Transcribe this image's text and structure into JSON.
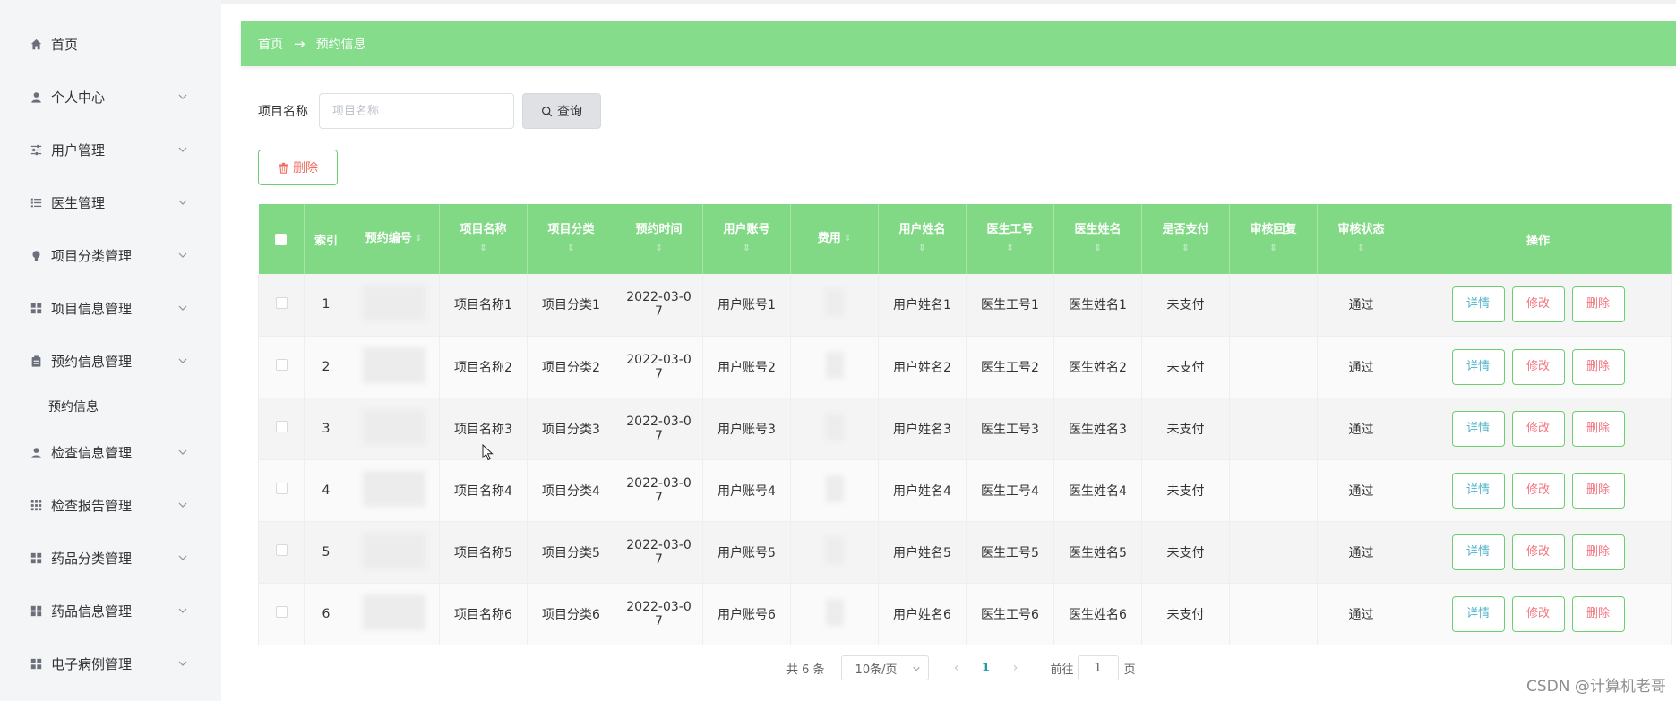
{
  "sidebar": {
    "items": [
      {
        "label": "首页",
        "icon": "home-icon",
        "has_arrow": false
      },
      {
        "label": "个人中心",
        "icon": "user-icon",
        "has_arrow": true
      },
      {
        "label": "用户管理",
        "icon": "sliders-icon",
        "has_arrow": true
      },
      {
        "label": "医生管理",
        "icon": "list-icon",
        "has_arrow": true
      },
      {
        "label": "项目分类管理",
        "icon": "bulb-icon",
        "has_arrow": true
      },
      {
        "label": "项目信息管理",
        "icon": "grid-icon",
        "has_arrow": true
      },
      {
        "label": "预约信息管理",
        "icon": "clipboard-icon",
        "has_arrow": true
      },
      {
        "label": "预约信息",
        "submenu": true
      },
      {
        "label": "检查信息管理",
        "icon": "user-icon",
        "has_arrow": true
      },
      {
        "label": "检查报告管理",
        "icon": "apps-icon",
        "has_arrow": true
      },
      {
        "label": "药品分类管理",
        "icon": "grid-icon",
        "has_arrow": true
      },
      {
        "label": "药品信息管理",
        "icon": "grid-icon",
        "has_arrow": true
      },
      {
        "label": "电子病例管理",
        "icon": "grid-icon",
        "has_arrow": true
      }
    ]
  },
  "breadcrumb": {
    "home": "首页",
    "separator": "→",
    "current": "预约信息"
  },
  "search": {
    "label": "项目名称",
    "placeholder": "项目名称",
    "value": "",
    "button_label": "查询"
  },
  "toolbar": {
    "delete_label": "删除"
  },
  "table": {
    "headers": {
      "index": "索引",
      "booking_no": "预约编号",
      "project_name": "项目名称",
      "project_category": "项目分类",
      "booking_time": "预约时间",
      "user_account": "用户账号",
      "fee": "费用",
      "user_name": "用户姓名",
      "doctor_id": "医生工号",
      "doctor_name": "医生姓名",
      "paid": "是否支付",
      "review_reply": "审核回复",
      "review_status": "审核状态",
      "actions": "操作"
    },
    "rows": [
      {
        "index": "1",
        "project_name": "项目名称1",
        "project_category": "项目分类1",
        "booking_time_1": "2022-03-0",
        "booking_time_2": "7",
        "user_account": "用户账号1",
        "user_name": "用户姓名1",
        "doctor_id": "医生工号1",
        "doctor_name": "医生姓名1",
        "paid": "未支付",
        "review_reply": "",
        "review_status": "通过"
      },
      {
        "index": "2",
        "project_name": "项目名称2",
        "project_category": "项目分类2",
        "booking_time_1": "2022-03-0",
        "booking_time_2": "7",
        "user_account": "用户账号2",
        "user_name": "用户姓名2",
        "doctor_id": "医生工号2",
        "doctor_name": "医生姓名2",
        "paid": "未支付",
        "review_reply": "",
        "review_status": "通过"
      },
      {
        "index": "3",
        "project_name": "项目名称3",
        "project_category": "项目分类3",
        "booking_time_1": "2022-03-0",
        "booking_time_2": "7",
        "user_account": "用户账号3",
        "user_name": "用户姓名3",
        "doctor_id": "医生工号3",
        "doctor_name": "医生姓名3",
        "paid": "未支付",
        "review_reply": "",
        "review_status": "通过"
      },
      {
        "index": "4",
        "project_name": "项目名称4",
        "project_category": "项目分类4",
        "booking_time_1": "2022-03-0",
        "booking_time_2": "7",
        "user_account": "用户账号4",
        "user_name": "用户姓名4",
        "doctor_id": "医生工号4",
        "doctor_name": "医生姓名4",
        "paid": "未支付",
        "review_reply": "",
        "review_status": "通过"
      },
      {
        "index": "5",
        "project_name": "项目名称5",
        "project_category": "项目分类5",
        "booking_time_1": "2022-03-0",
        "booking_time_2": "7",
        "user_account": "用户账号5",
        "user_name": "用户姓名5",
        "doctor_id": "医生工号5",
        "doctor_name": "医生姓名5",
        "paid": "未支付",
        "review_reply": "",
        "review_status": "通过"
      },
      {
        "index": "6",
        "project_name": "项目名称6",
        "project_category": "项目分类6",
        "booking_time_1": "2022-03-0",
        "booking_time_2": "7",
        "user_account": "用户账号6",
        "user_name": "用户姓名6",
        "doctor_id": "医生工号6",
        "doctor_name": "医生姓名6",
        "paid": "未支付",
        "review_reply": "",
        "review_status": "通过"
      }
    ],
    "action_labels": {
      "detail": "详情",
      "edit": "修改",
      "delete": "删除"
    }
  },
  "pagination": {
    "total": "共 6 条",
    "page_size": "10条/页",
    "current_page": "1",
    "goto_label": "前往",
    "goto_value": "1",
    "page_suffix": "页"
  },
  "watermark": "CSDN @计算机老哥",
  "colors": {
    "accent": "#85dc8b",
    "table_header": "#82d985",
    "danger_text": "#f37580",
    "detail_text": "#4fb3c9"
  }
}
